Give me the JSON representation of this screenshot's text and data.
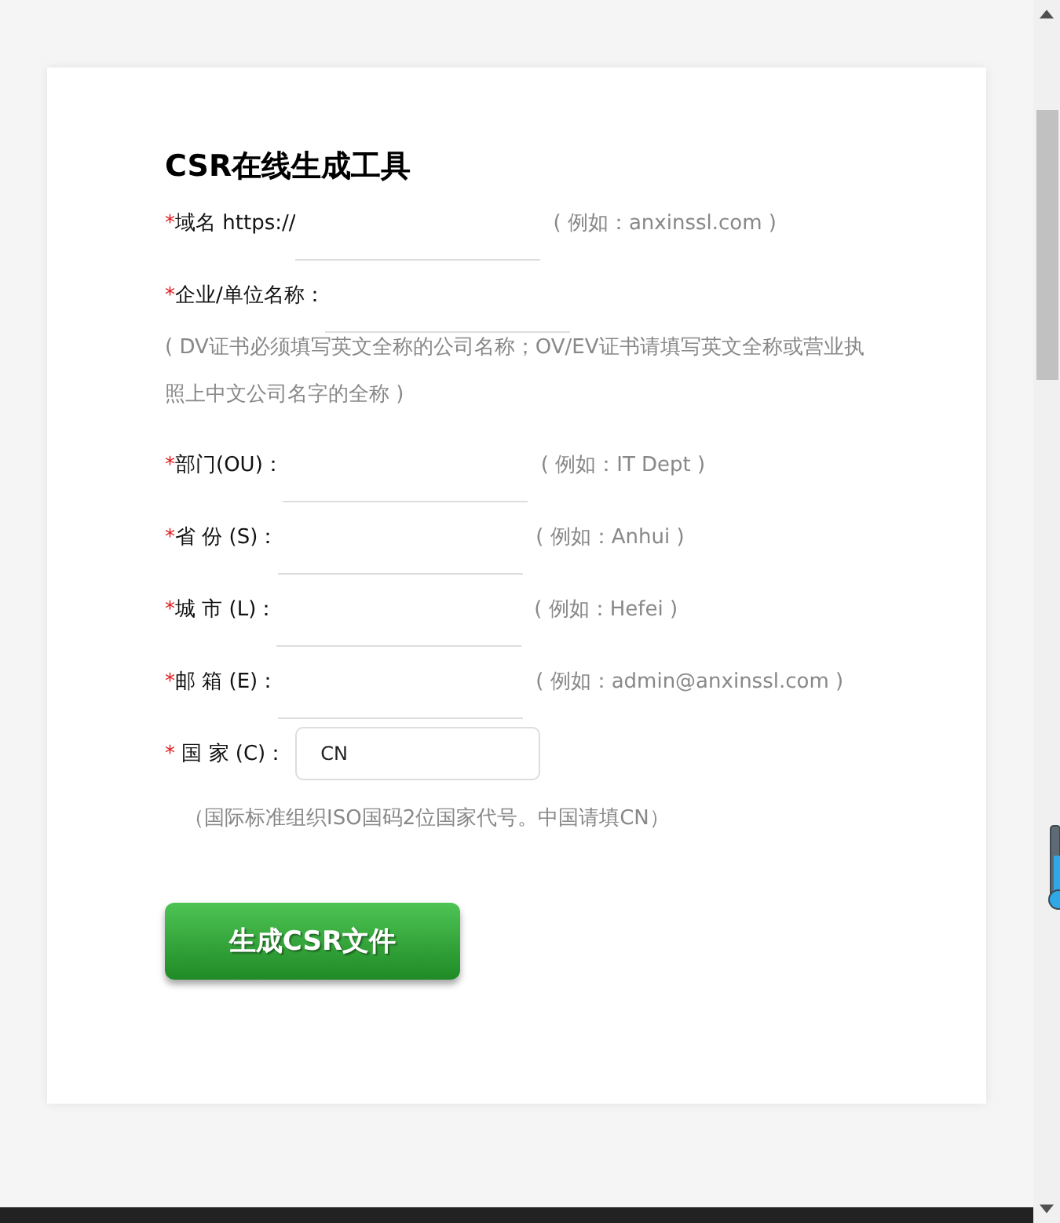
{
  "title": "CSR在线生成工具",
  "required_mark": "*",
  "fields": [
    {
      "kind": "line",
      "required": true,
      "label": "域名 https://",
      "example": "( 例如：anxinssl.com )"
    },
    {
      "kind": "line",
      "required": true,
      "label": "企业/单位名称：",
      "note": "( DV证书必须填写英文全称的公司名称；OV/EV证书请填写英文全称或营业执照上中文公司名字的全称 )"
    },
    {
      "kind": "line",
      "required": true,
      "label": "部门(OU)：",
      "example": "( 例如：IT Dept )"
    },
    {
      "kind": "line",
      "required": true,
      "label": "省 份 (S)：",
      "example": "( 例如：Anhui )"
    },
    {
      "kind": "line",
      "required": true,
      "label": "城 市 (L)：",
      "example": "( 例如：Hefei )"
    },
    {
      "kind": "line",
      "required": true,
      "label": "邮 箱 (E)：",
      "example": "( 例如：admin@anxinssl.com )"
    },
    {
      "kind": "box",
      "required": true,
      "label": " 国 家 (C)：",
      "value": "CN",
      "note": "（国际标准组织ISO国码2位国家代号。中国请填CN）"
    }
  ],
  "button": "生成CSR文件"
}
